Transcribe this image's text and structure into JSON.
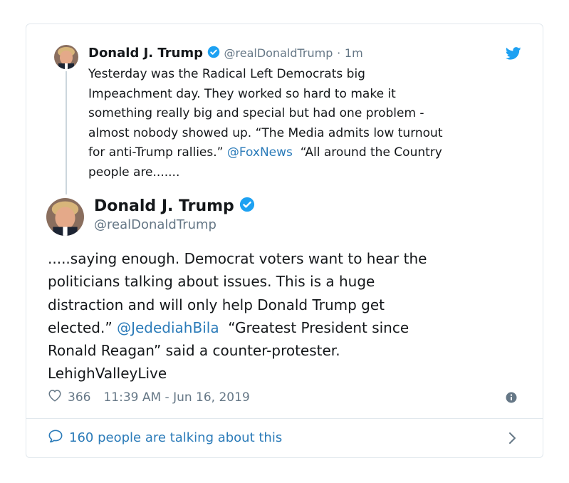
{
  "quoted_tweet": {
    "name": "Donald J. Trump",
    "handle": "@realDonaldTrump",
    "separator": "·",
    "time": "1m",
    "lines": [
      "Yesterday was the Radical Left Democrats big",
      "Impeachment day. They worked so hard to make it",
      "something really big and special but had one problem -",
      "almost nobody showed up. “The Media admits low turnout"
    ],
    "line5_pre": "for anti-Trump rallies.”",
    "line5_link": "@FoxNews",
    "line5_post": "“All around the Country",
    "line6": "people are......."
  },
  "main_tweet": {
    "name": "Donald J. Trump",
    "handle": "@realDonaldTrump",
    "lines": [
      ".....saying enough. Democrat voters want to hear the",
      "politicians talking about issues. This is a huge",
      "distraction and will only help Donald Trump get"
    ],
    "line4_pre": "elected.”",
    "line4_link": "@JedediahBila",
    "line4_post": "“Greatest President since",
    "line5": "Ronald Reagan” said a counter-protester.",
    "line6": "LehighValleyLive",
    "likes": "366",
    "timestamp": "11:39 AM - Jun 16, 2019"
  },
  "footer": {
    "label": "160 people are talking about this"
  },
  "colors": {
    "accent": "#1da1f2",
    "link": "#2b7bb9",
    "muted": "#657786",
    "border": "#e1e8ed"
  }
}
